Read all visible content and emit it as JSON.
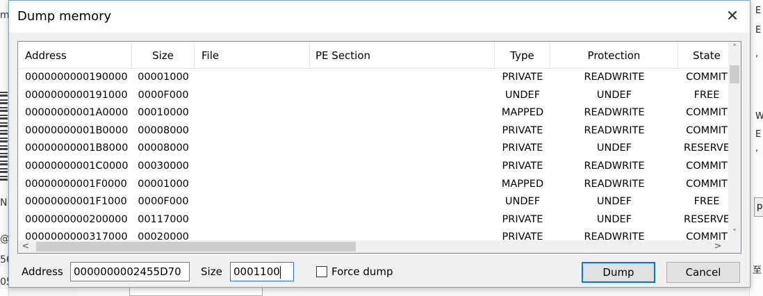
{
  "dialog": {
    "title": "Dump memory",
    "close_glyph": "✕"
  },
  "table": {
    "columns": [
      "Address",
      "Size",
      "File",
      "PE Section",
      "Type",
      "Protection",
      "State"
    ],
    "rows": [
      [
        "0000000000190000",
        "00001000",
        "",
        "",
        "PRIVATE",
        "READWRITE",
        "COMMIT"
      ],
      [
        "0000000000191000",
        "0000F000",
        "",
        "",
        "UNDEF",
        "UNDEF",
        "FREE"
      ],
      [
        "00000000001A0000",
        "00010000",
        "",
        "",
        "MAPPED",
        "READWRITE",
        "COMMIT"
      ],
      [
        "00000000001B0000",
        "00008000",
        "",
        "",
        "PRIVATE",
        "READWRITE",
        "COMMIT"
      ],
      [
        "00000000001B8000",
        "00008000",
        "",
        "",
        "PRIVATE",
        "UNDEF",
        "RESERVE"
      ],
      [
        "00000000001C0000",
        "00030000",
        "",
        "",
        "PRIVATE",
        "READWRITE",
        "COMMIT"
      ],
      [
        "00000000001F0000",
        "00001000",
        "",
        "",
        "MAPPED",
        "READWRITE",
        "COMMIT"
      ],
      [
        "00000000001F1000",
        "0000F000",
        "",
        "",
        "UNDEF",
        "UNDEF",
        "FREE"
      ],
      [
        "0000000000200000",
        "00117000",
        "",
        "",
        "PRIVATE",
        "UNDEF",
        "RESERVE"
      ],
      [
        "0000000000317000",
        "00020000",
        "",
        "",
        "PRIVATE",
        "READWRITE",
        "COMMIT"
      ]
    ]
  },
  "form": {
    "address_label": "Address",
    "address_value": "0000000002455D70",
    "size_label": "Size",
    "size_value": "0001100",
    "force_dump_label": "Force dump",
    "force_dump_checked": false,
    "dump_button": "Dump",
    "cancel_button": "Cancel"
  },
  "icons": {
    "scroll_up": "˄",
    "scroll_down": "˅",
    "scroll_left": "<",
    "scroll_right": ">"
  },
  "background": {
    "left_fragments": [
      "m",
      "N",
      "@",
      "56",
      "05"
    ],
    "right_fragments": [
      "E",
      "E",
      ",",
      "W",
      "E",
      ",",
      "p",
      "至"
    ]
  }
}
